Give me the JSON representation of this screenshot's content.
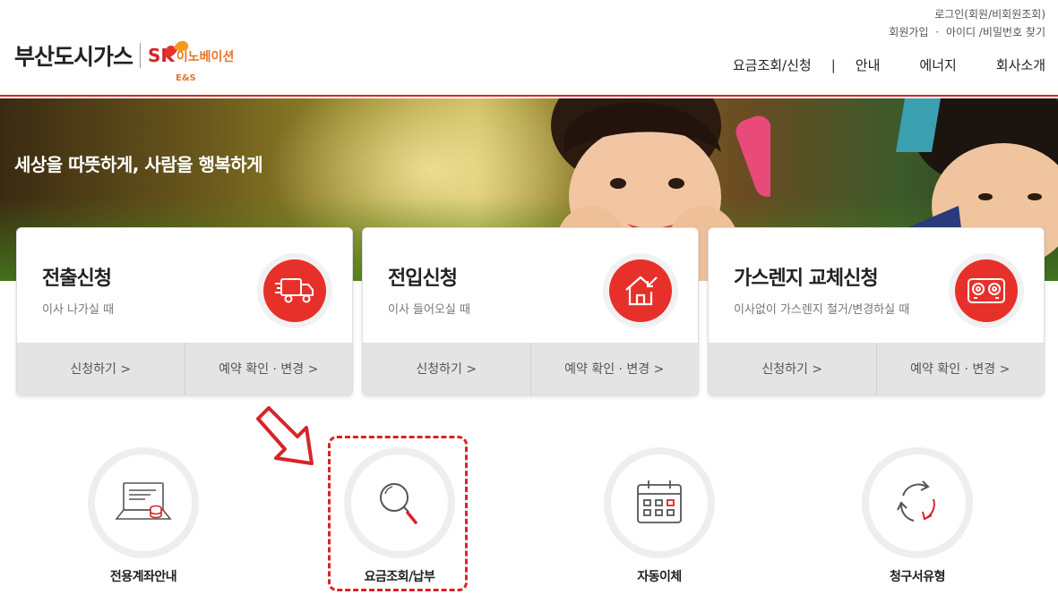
{
  "brand": {
    "name_ko": "부산도시가스",
    "sk": "SK",
    "innovation": "이노베이션",
    "es": "E&S"
  },
  "util": {
    "line1": "로그인(회원/비회원조회)",
    "signup": "회원가입",
    "find": "아이디 /비밀번호 찾기"
  },
  "gnb": {
    "items": [
      "요금조회/신청",
      "안내",
      "에너지",
      "회사소개"
    ]
  },
  "hero": {
    "copy": "세상을 따뜻하게, 사람을 행복하게"
  },
  "cards": [
    {
      "title": "전출신청",
      "desc": "이사 나가실 때",
      "icon": "moving-truck-icon",
      "apply": "신청하기 >",
      "check": "예약 확인 · 변경 >"
    },
    {
      "title": "전입신청",
      "desc": "이사 들어오실 때",
      "icon": "house-in-icon",
      "apply": "신청하기 >",
      "check": "예약 확인 · 변경 >"
    },
    {
      "title": "가스렌지 교체신청",
      "desc": "이사없이 가스렌지 철거/변경하실 때",
      "icon": "gas-range-icon",
      "apply": "신청하기 >",
      "check": "예약 확인 · 변경 >"
    }
  ],
  "quick": [
    {
      "label": "전용계좌안내",
      "icon": "laptop-coins-icon"
    },
    {
      "label": "요금조회/납부",
      "icon": "magnifier-icon"
    },
    {
      "label": "자동이체",
      "icon": "calendar-icon"
    },
    {
      "label": "청구서유형",
      "icon": "recycle-arrows-icon"
    }
  ],
  "colors": {
    "accent": "#e8302a",
    "brand_red": "#d8232a",
    "brand_orange": "#e8752a"
  }
}
